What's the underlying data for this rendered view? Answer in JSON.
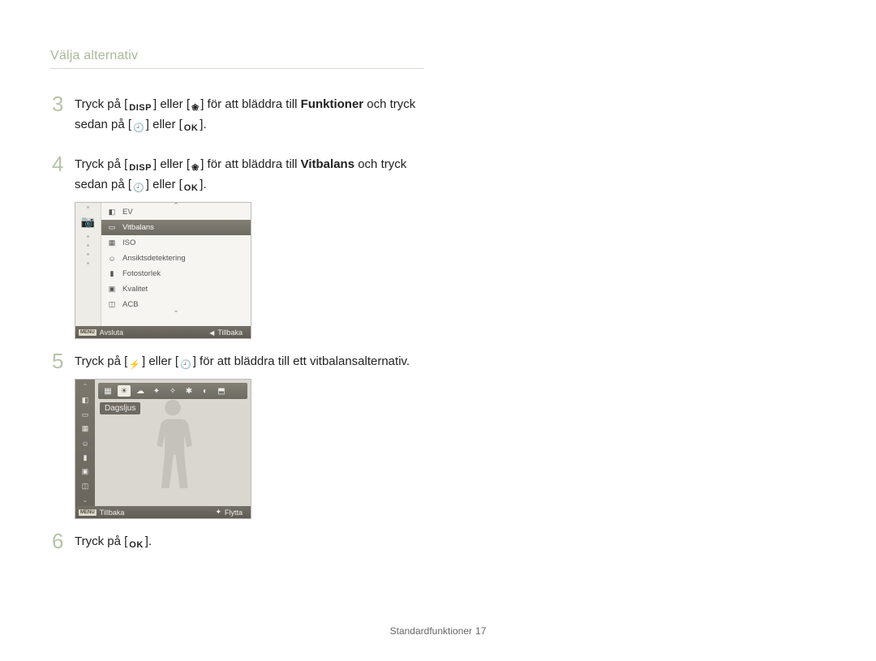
{
  "header": {
    "title": "Välja alternativ"
  },
  "icons": {
    "disp": "DISP",
    "ok": "OK"
  },
  "steps": {
    "s3": {
      "num": "3",
      "t1": "Tryck på [",
      "t2": "] eller [",
      "t3": "] för att bläddra till ",
      "bold": "Funktioner",
      "t4": " och tryck sedan på [",
      "t5": "] eller [",
      "t6": "]."
    },
    "s4": {
      "num": "4",
      "t1": "Tryck på [",
      "t2": "] eller [",
      "t3": "] för att bläddra till ",
      "bold": "Vitbalans",
      "t4": " och tryck sedan på [",
      "t5": "] eller [",
      "t6": "]."
    },
    "s5": {
      "num": "5",
      "t1": "Tryck på [",
      "t2": "] eller [",
      "t3": "] för att bläddra till ett vitbalansalternativ."
    },
    "s6": {
      "num": "6",
      "t1": "Tryck på [",
      "t2": "]."
    }
  },
  "lcd1": {
    "items": [
      {
        "icon": "◧",
        "label": "EV"
      },
      {
        "icon": "▭",
        "label": "Vitbalans",
        "selected": true
      },
      {
        "icon": "▦",
        "label": "ISO"
      },
      {
        "icon": "☺",
        "label": "Ansiktsdetektering"
      },
      {
        "icon": "▮",
        "label": "Fotostorlek"
      },
      {
        "icon": "▣",
        "label": "Kvalitet"
      },
      {
        "icon": "◫",
        "label": "ACB"
      }
    ],
    "footer": {
      "menu": "MENU",
      "left": "Avsluta",
      "right": "Tillbaka"
    }
  },
  "lcd2": {
    "side": [
      "◧",
      "▭",
      "▦",
      "☺",
      "▮",
      "▣",
      "◫"
    ],
    "wb_icons": [
      "▦",
      "☀",
      "☁",
      "✦",
      "✧",
      "✱",
      "◐",
      "⬒"
    ],
    "wb_selected_index": 1,
    "wb_label": "Dagsljus",
    "footer": {
      "menu": "MENU",
      "left": "Tillbaka",
      "right": "Flytta"
    }
  },
  "footer": {
    "section": "Standardfunktioner",
    "page": "17"
  }
}
